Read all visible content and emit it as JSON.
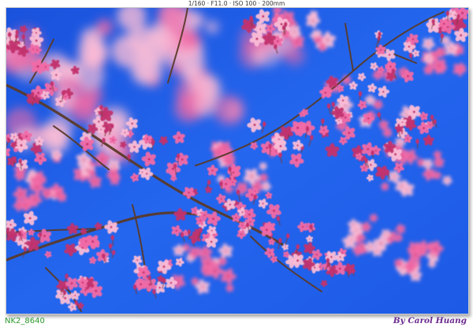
{
  "exif_line": "1/160 · F11.0 · ISO 100 · 200mm",
  "filename_caption": "NK2_8640",
  "credit_caption": "By Carol Huang",
  "colors": {
    "sky": "#1f5fe8",
    "sky_dark": "#1346c9",
    "blossom": "#f06aa6",
    "blossom_light": "#f9bcd6",
    "blossom_deep": "#c2336e",
    "branch": "#5a3a2a",
    "filename_text": "#2e9a2e",
    "credit_text": "#6b2a8f"
  },
  "photo": {
    "subject": "pink cherry blossom branches against a clear blue sky"
  }
}
